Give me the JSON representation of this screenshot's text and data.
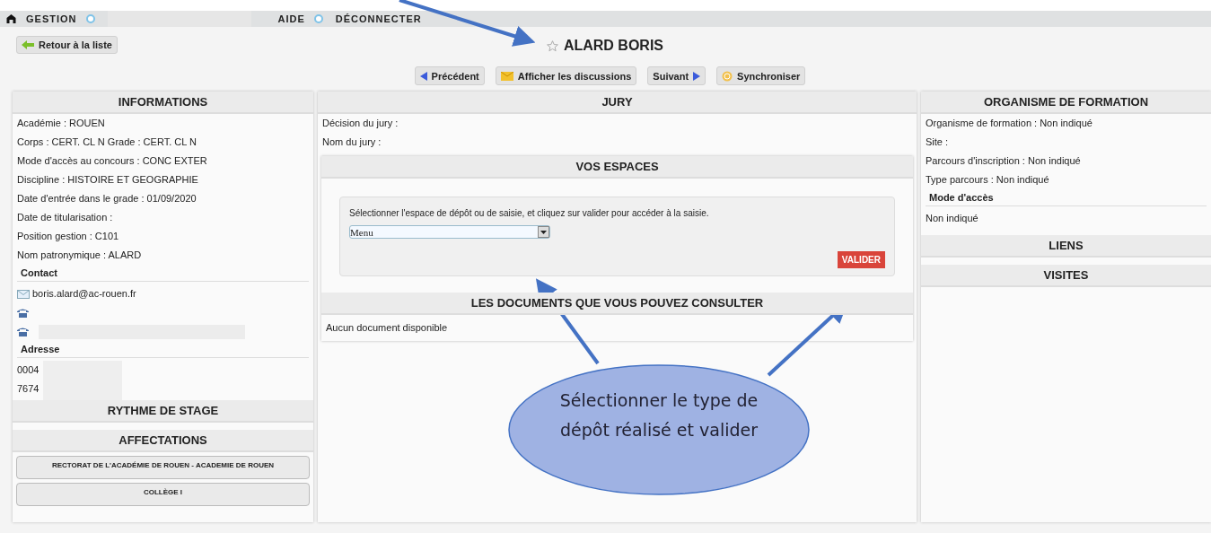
{
  "nav": {
    "items": [
      {
        "label": "GESTION",
        "has_dropdown": true
      },
      {
        "label": "AIDE",
        "has_dropdown": true
      },
      {
        "label": "DÉCONNECTER",
        "has_dropdown": false
      }
    ]
  },
  "header": {
    "back_button": "Retour à la liste",
    "title": "ALARD BORIS",
    "starred": false
  },
  "toolbar": [
    {
      "kind": "prev",
      "label": "Précédent"
    },
    {
      "kind": "mail",
      "label": "Afficher les discussions"
    },
    {
      "kind": "next",
      "label": "Suivant"
    },
    {
      "kind": "sync",
      "label": "Synchroniser"
    }
  ],
  "informations": {
    "title": "INFORMATIONS",
    "fields": [
      "Académie : ROUEN",
      "Corps : CERT. CL N Grade : CERT. CL N",
      "Mode d'accès au concours : CONC EXTER",
      "Discipline : HISTOIRE ET GEOGRAPHIE",
      "Date d'entrée dans le grade : 01/09/2020",
      "Date de titularisation :",
      "Position gestion : C101",
      "Nom patronymique : ALARD"
    ],
    "contact": {
      "title": "Contact",
      "email": "boris.alard@ac-rouen.fr",
      "phones": [
        {
          "redacted": false
        },
        {
          "redacted": true
        }
      ]
    },
    "address": {
      "title": "Adresse",
      "lines": [
        "0004",
        "7674"
      ]
    }
  },
  "rythme": {
    "title": "RYTHME DE STAGE"
  },
  "affectations": {
    "title": "AFFECTATIONS",
    "items": [
      "RECTORAT DE L'ACADÉMIE DE ROUEN - ACADEMIE DE ROUEN",
      "COLLÈGE I"
    ]
  },
  "jury": {
    "title": "JURY",
    "fields": [
      "Décision du jury :",
      "Nom du jury :"
    ]
  },
  "espaces": {
    "title": "VOS ESPACES",
    "instruction": "Sélectionner l'espace de dépôt ou de saisie, et cliquez sur valider pour accéder à la saisie.",
    "select_value": "Menu",
    "button": "VALIDER"
  },
  "documents": {
    "title": "LES DOCUMENTS QUE VOUS POUVEZ CONSULTER",
    "text": "Aucun document disponible"
  },
  "organisme": {
    "title": "ORGANISME DE FORMATION",
    "fields": [
      "Organisme de formation : Non indiqué",
      "Site :",
      "Parcours d'inscription : Non indiqué",
      "Type parcours : Non indiqué"
    ],
    "mode_title": "Mode d'accès",
    "mode_value": "Non indiqué"
  },
  "right_sections": [
    "LIENS",
    "VISITES"
  ],
  "annotation": {
    "callout": "Sélectionner le type de dépôt réalisé et valider"
  }
}
